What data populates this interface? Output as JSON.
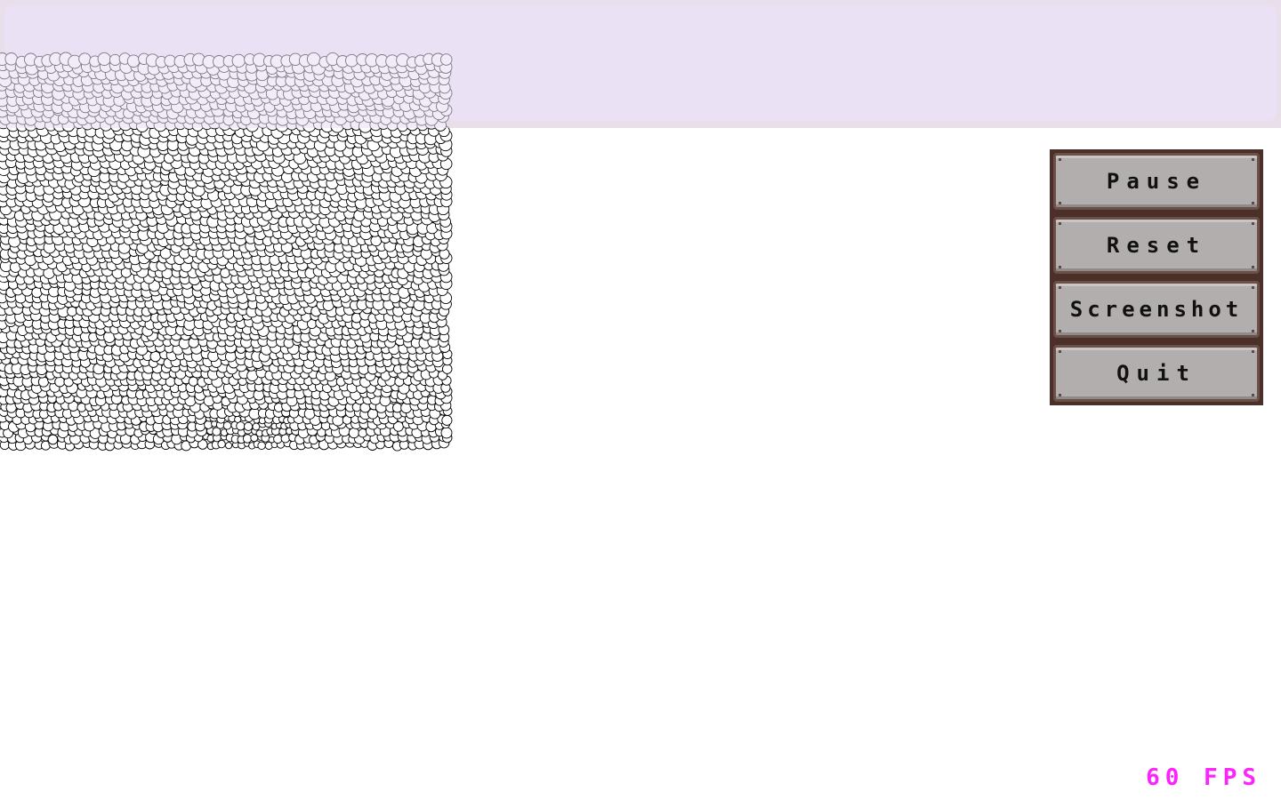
{
  "window": {
    "background_color": "#ffffff",
    "banner_color": "#f0e7f7"
  },
  "simulation": {
    "particle_fill": "#ffffff",
    "particle_stroke": "#000000",
    "particle_shape": "circle"
  },
  "menu": {
    "buttons": [
      {
        "label": "Pause",
        "name": "pause-button"
      },
      {
        "label": "Reset",
        "name": "reset-button"
      },
      {
        "label": "Screenshot",
        "name": "screenshot-button"
      },
      {
        "label": "Quit",
        "name": "quit-button"
      }
    ],
    "frame_color": "#4a3028",
    "button_color": "#b3aeae"
  },
  "status": {
    "fps_label": "60 FPS",
    "fps_color": "#ff22ff"
  }
}
